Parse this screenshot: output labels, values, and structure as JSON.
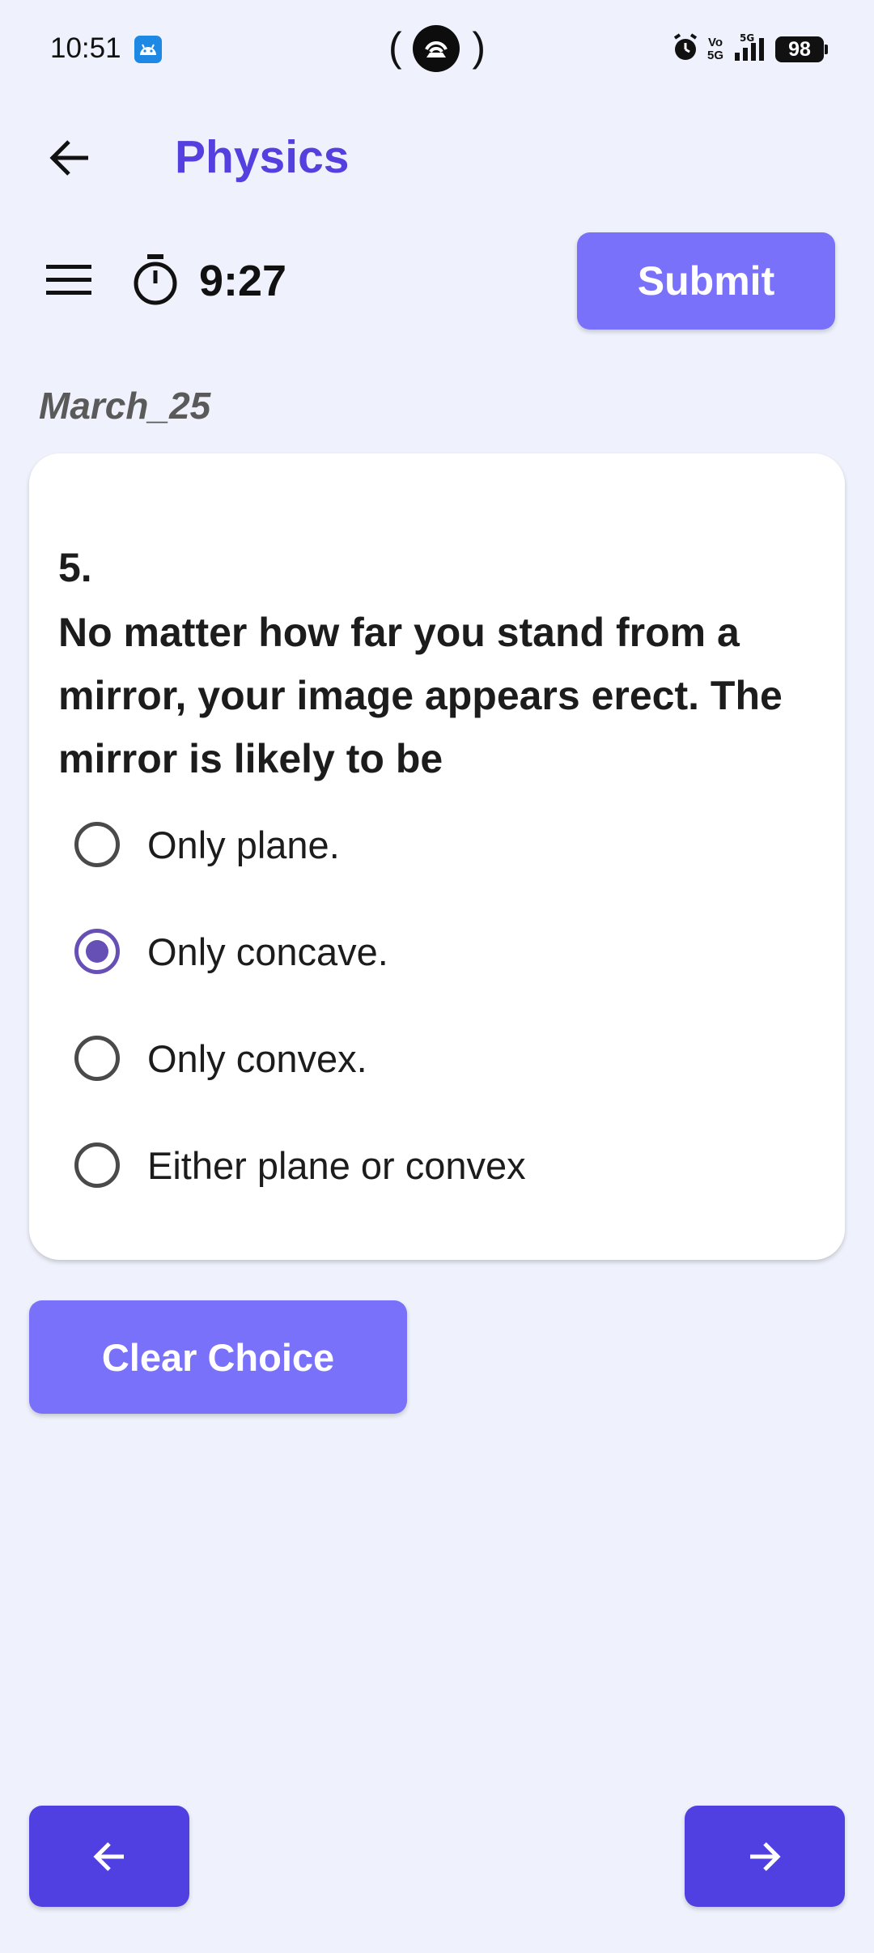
{
  "status_bar": {
    "time": "10:51",
    "battery": "98",
    "volte": "Vo 5G",
    "icons": [
      "android-icon",
      "hotspot-icon",
      "alarm-icon",
      "volte-icon",
      "signal-5g-icon",
      "battery-icon"
    ]
  },
  "header": {
    "title": "Physics",
    "back_icon": "arrow-left-icon"
  },
  "toolbar": {
    "menu_icon": "hamburger-menu-icon",
    "timer_icon": "stopwatch-icon",
    "timer": "9:27",
    "submit_label": "Submit"
  },
  "section": "March_25",
  "question": {
    "number": "5.",
    "text": "No matter how far you stand from a mirror, your image appears erect. The mirror is likely to be",
    "options": [
      {
        "label": "Only plane.",
        "selected": false
      },
      {
        "label": "Only concave.",
        "selected": true
      },
      {
        "label": "Only convex.",
        "selected": false
      },
      {
        "label": "Either plane or convex",
        "selected": false
      }
    ]
  },
  "clear_label": "Clear Choice",
  "navigation": {
    "prev_icon": "arrow-left-icon",
    "next_icon": "arrow-right-icon"
  },
  "colors": {
    "accent": "#5340de",
    "button": "#7a71fb",
    "nav_button": "#5040e2",
    "radio_selected": "#6650b5",
    "background": "#eff2fc"
  }
}
